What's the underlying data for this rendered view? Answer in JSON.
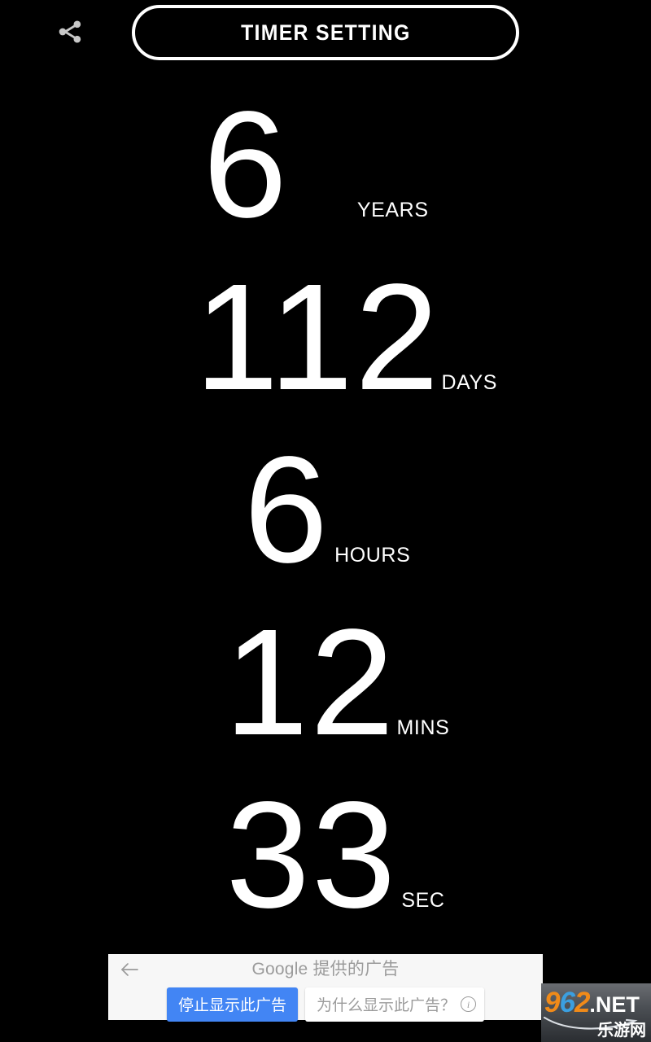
{
  "app": {
    "background_color": "#000000",
    "foreground_color": "#ffffff"
  },
  "topbar": {
    "share_icon": "share-icon",
    "timer_setting_label": "TIMER SETTING"
  },
  "countdown": {
    "units": [
      {
        "value": "6",
        "label": "YEARS"
      },
      {
        "value": "112",
        "label": "DAYS"
      },
      {
        "value": "6",
        "label": "HOURS"
      },
      {
        "value": "12",
        "label": "MINS"
      },
      {
        "value": "33",
        "label": "SEC"
      }
    ]
  },
  "ad": {
    "back_icon": "back-arrow-icon",
    "header": "Google 提供的广告",
    "stop_button": "停止显示此广告",
    "why_button": "为什么显示此广告？",
    "info_icon": "info-circle-icon",
    "accent_color": "#4285f4",
    "background_color": "#f7f7f7",
    "text_color": "#9b9b9b"
  },
  "watermark": {
    "digit_9": "9",
    "digit_6": "6",
    "digit_2": "2",
    "net": ".NET",
    "subtitle": "乐游网",
    "orange": "#f08a19",
    "blue": "#3b9fe0"
  }
}
